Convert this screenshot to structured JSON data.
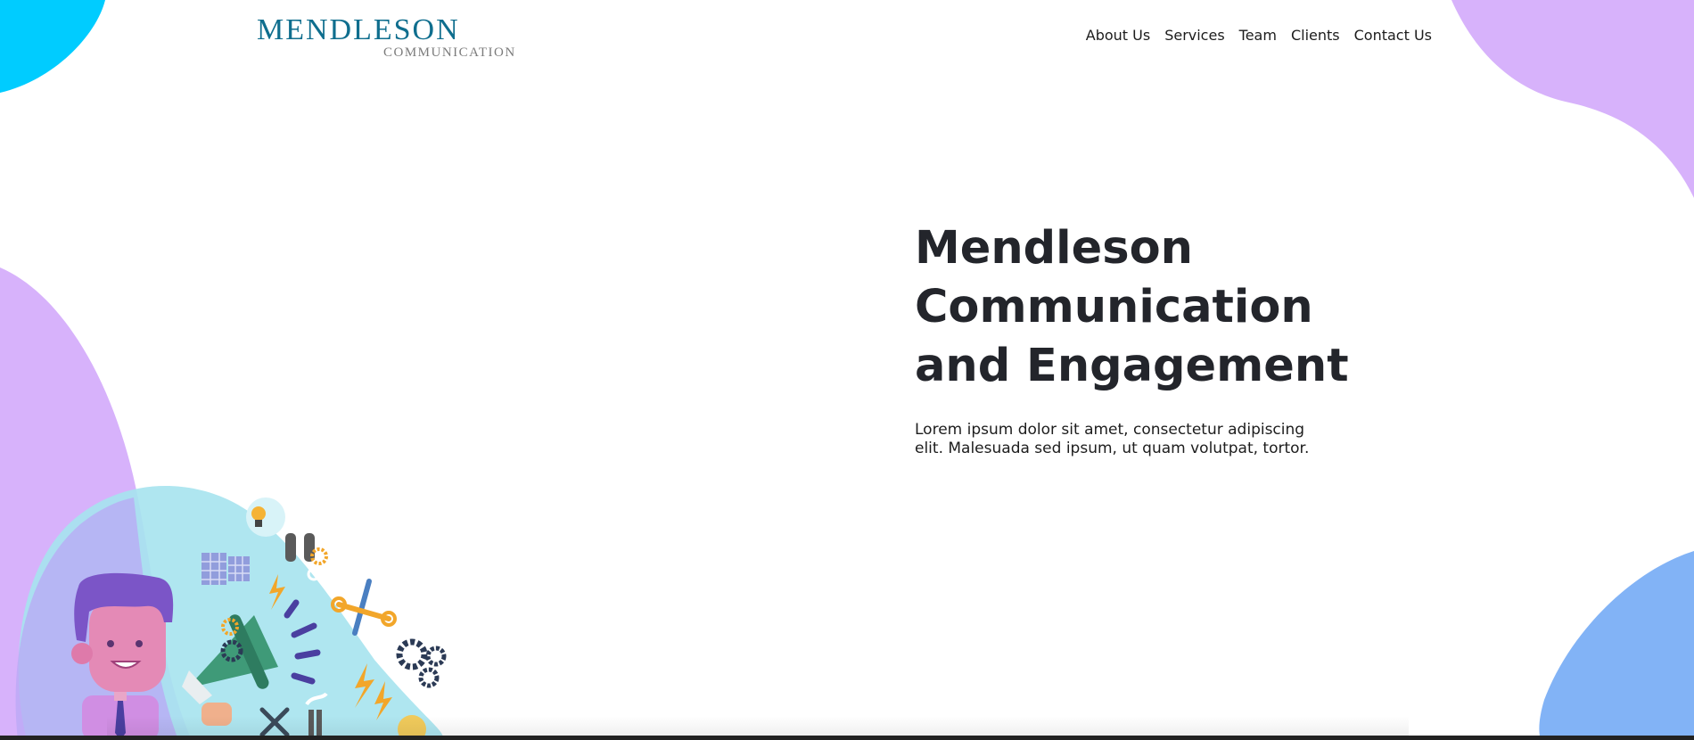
{
  "brand": {
    "name": "MENDLESON",
    "tagline": "COMMUNICATION"
  },
  "nav": {
    "items": [
      {
        "label": "About Us"
      },
      {
        "label": "Services"
      },
      {
        "label": "Team"
      },
      {
        "label": "Clients"
      },
      {
        "label": "Contact Us"
      }
    ]
  },
  "hero": {
    "title_lines": [
      "Mendleson",
      "Communication",
      "and Engagement"
    ],
    "description": "Lorem ipsum dolor sit amet, consectetur adipiscing elit. Malesuada sed ipsum, ut quam volutpat, tortor."
  },
  "colors": {
    "cyan": "#00ccff",
    "lilac": "#d7b2fb",
    "blue": "#82b3f6",
    "teal_blob": "#a6e3ee",
    "brand": "#0f6e8e",
    "heading": "#23252b"
  },
  "illustration": {
    "icons": [
      "person-icon",
      "megaphone-icon",
      "lightbulb-icon",
      "gear-icon",
      "lightning-icon",
      "wrench-icon",
      "solar-panel-icon",
      "factory-icon"
    ]
  }
}
